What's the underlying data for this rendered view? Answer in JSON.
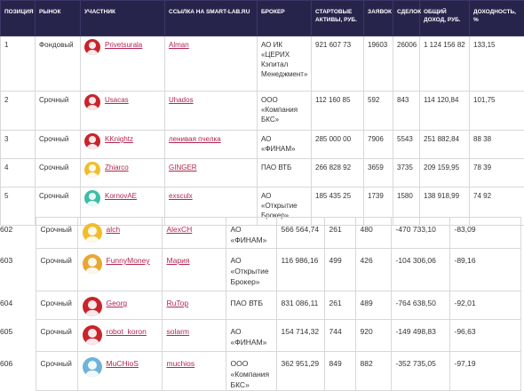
{
  "header": {
    "position": "ПОЗИЦИЯ",
    "market": "РЫНОК",
    "participant": "УЧАСТНИК",
    "link": "ССЫЛКА НА SMART-LAB.RU",
    "broker": "БРОКЕР",
    "start_assets": "СТАРТОВЫЕ АКТИВЫ, РУБ.",
    "orders": "ЗАЯВОК",
    "deals": "СДЕЛОК",
    "income": "ОБЩИЙ ДОХОД, РУБ.",
    "yield": "ДОХОДНОСТЬ, %"
  },
  "top_rows": [
    {
      "pos": "1",
      "market": "Фондовый",
      "user": "Privetsurala",
      "avatar_color": "#c8242b",
      "link": "Alman",
      "broker": "АО ИК «ЦЕРИХ Кэпитал Менеджмент»",
      "assets": "921 607 73",
      "orders": "19603",
      "deals": "26006",
      "income": "1 124 156 82",
      "yield": "133,15"
    },
    {
      "pos": "2",
      "market": "Срочный",
      "user": "Usacas",
      "avatar_color": "#c8242b",
      "link": "Uhados",
      "broker": "ООО «Компания БКС»",
      "assets": "112 160 85",
      "orders": "592",
      "deals": "843",
      "income": "114 120,84",
      "yield": "101,75"
    },
    {
      "pos": "3",
      "market": "Срочный",
      "user": "KKnightz",
      "avatar_color": "#c8242b",
      "link": "ленивая пчелка",
      "broker": "АО «ФИНАМ»",
      "assets": "285 000 00",
      "orders": "7906",
      "deals": "5543",
      "income": "251 882,84",
      "yield": "88 38"
    },
    {
      "pos": "4",
      "market": "Срочный",
      "user": "Zhiarco",
      "avatar_color": "#f0bd2c",
      "link": "GINGER",
      "broker": "ПАО ВТБ",
      "assets": "266 828 92",
      "orders": "3659",
      "deals": "3735",
      "income": "209 159,95",
      "yield": "78 39"
    },
    {
      "pos": "5",
      "market": "Срочный",
      "user": "KornovAE",
      "avatar_color": "#3bbfa6",
      "link": "exsculx",
      "broker": "АО «Открытие Брокер»",
      "assets": "185 435 25",
      "orders": "1739",
      "deals": "1580",
      "income": "138 918,99",
      "yield": "74 92"
    }
  ],
  "bottom_rows": [
    {
      "pos": "602",
      "market": "Срочный",
      "user": "alch",
      "avatar_color": "#f0bd2c",
      "link": "AlexCH",
      "broker": "АО «ФИНАМ»",
      "assets": "566 564,74",
      "orders": "261",
      "deals": "480",
      "income": "-470 733,10",
      "yield": "-83,09"
    },
    {
      "pos": "603",
      "market": "Срочный",
      "user": "FunnyMoney",
      "avatar_color": "#e8a733",
      "link": "Мария",
      "broker": "АО «Открытие Брокер»",
      "assets": "116 986,16",
      "orders": "499",
      "deals": "426",
      "income": "-104 306,06",
      "yield": "-89,16"
    },
    {
      "pos": "604",
      "market": "Срочный",
      "user": "Georg",
      "avatar_color": "#c8242b",
      "link": "RuTop",
      "broker": "ПАО ВТБ",
      "assets": "831 086,11",
      "orders": "261",
      "deals": "489",
      "income": "-764 638,50",
      "yield": "-92,01"
    },
    {
      "pos": "605",
      "market": "Срочный",
      "user": "robot_koron",
      "avatar_color": "#c8242b",
      "link": "solarm",
      "broker": "АО «ФИНАМ»",
      "assets": "154 714,32",
      "orders": "744",
      "deals": "920",
      "income": "-149 498,83",
      "yield": "-96,63"
    },
    {
      "pos": "606",
      "market": "Срочный",
      "user": "MuCHioS",
      "avatar_color": "#6fb3d8",
      "link": "muchios",
      "broker": "ООО «Компания БКС»",
      "assets": "362 951,29",
      "orders": "849",
      "deals": "882",
      "income": "-352 735,05",
      "yield": "-97,19"
    }
  ]
}
